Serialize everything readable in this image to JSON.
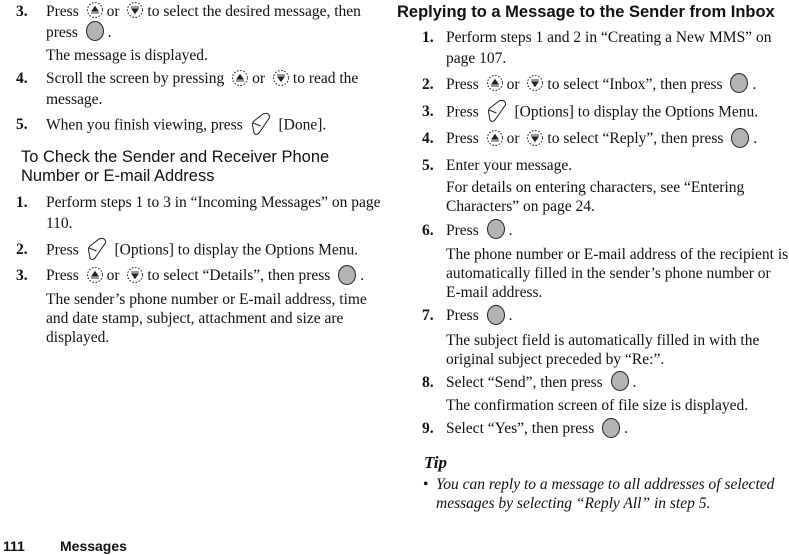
{
  "left": {
    "steps_a": [
      {
        "num": "3.",
        "parts": [
          "Press",
          "or",
          "to select the desired message, then press",
          "."
        ],
        "sub": "The message is displayed."
      },
      {
        "num": "4.",
        "parts": [
          "Scroll the screen by pressing",
          "or",
          "to read the message."
        ]
      },
      {
        "num": "5.",
        "parts": [
          "When you finish viewing, press",
          "[Done]."
        ]
      }
    ],
    "heading": "To Check the Sender and Receiver Phone Number or E-mail Address",
    "steps_b": [
      {
        "num": "1.",
        "text": "Perform steps 1 to 3 in “Incoming Messages” on page 110."
      },
      {
        "num": "2.",
        "parts": [
          "Press",
          "[Options] to display the Options Menu."
        ]
      },
      {
        "num": "3.",
        "parts": [
          "Press",
          "or",
          "to select “Details”, then press",
          "."
        ],
        "sub": "The sender’s phone number or E-mail address, time and date stamp, subject, attachment and size are displayed."
      }
    ]
  },
  "right": {
    "heading": "Replying  to a Message to the Sender from Inbox",
    "steps": [
      {
        "num": "1.",
        "text": "Perform steps 1 and 2 in “Creating a New MMS” on page 107."
      },
      {
        "num": "2.",
        "parts": [
          "Press",
          "or",
          "to select “Inbox”, then press",
          "."
        ]
      },
      {
        "num": "3.",
        "parts": [
          "Press",
          "[Options] to display the Options Menu."
        ]
      },
      {
        "num": "4.",
        "parts": [
          "Press",
          "or",
          "to select “Reply”, then press",
          "."
        ]
      },
      {
        "num": "5.",
        "text": "Enter your message.",
        "sub": "For details on entering characters, see “Entering Characters” on page 24."
      },
      {
        "num": "6.",
        "parts": [
          "Press",
          "."
        ],
        "sub": "The phone number or E-mail address of the recipient is automatically filled in the sender’s phone number or E-mail address."
      },
      {
        "num": "7.",
        "parts": [
          "Press",
          "."
        ],
        "sub": "The subject field is automatically filled in with the original subject preceded by “Re:”."
      },
      {
        "num": "8.",
        "parts": [
          "Select “Send”, then press",
          "."
        ],
        "sub": "The confirmation screen of file size is displayed."
      },
      {
        "num": "9.",
        "parts": [
          "Select “Yes”, then press",
          "."
        ]
      }
    ],
    "tip": {
      "title": "Tip",
      "bullet": "•",
      "items": [
        "You can reply to a message to all addresses of selected messages by selecting “Reply All” in step 5."
      ]
    }
  },
  "footer": {
    "page_number": "111",
    "section": "Messages"
  },
  "icons": {
    "nav_up": "nav-up-key",
    "nav_down": "nav-down-key",
    "center": "center-select-key",
    "softkey": "soft-key"
  },
  "colors": {
    "text": "#111111",
    "center_key_fill": "#b3b3b3"
  }
}
